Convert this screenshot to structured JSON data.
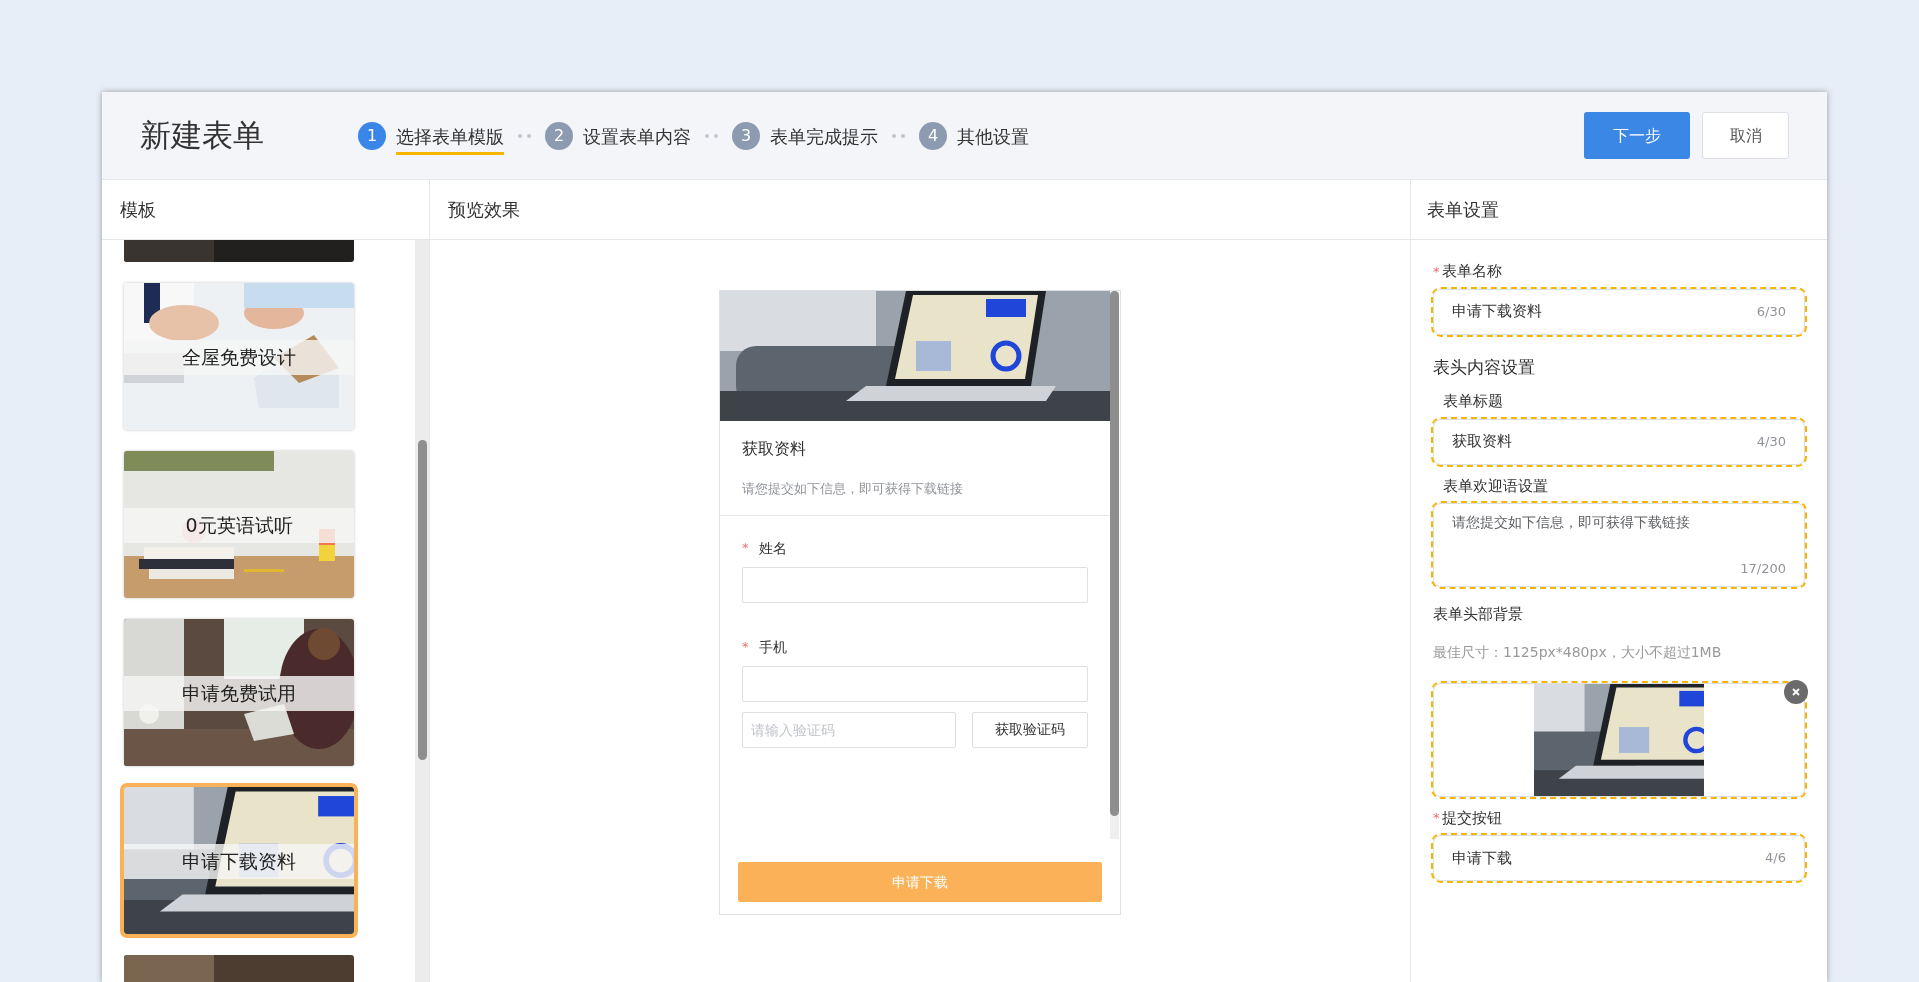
{
  "title": "新建表单",
  "steps": [
    {
      "number": "1",
      "label": "选择表单模版",
      "selected": true
    },
    {
      "number": "2",
      "label": "设置表单内容",
      "selected": false
    },
    {
      "number": "3",
      "label": "表单完成提示",
      "selected": false
    },
    {
      "number": "4",
      "label": "其他设置",
      "selected": false
    }
  ],
  "actions": {
    "next": "下一步",
    "cancel": "取消"
  },
  "columns": {
    "templates": "模板",
    "preview": "预览效果",
    "settings": "表单设置"
  },
  "templates": [
    {
      "selected": false
    },
    {
      "label": "全屋免费设计",
      "selected": false
    },
    {
      "label": "0元英语试听",
      "selected": false
    },
    {
      "label": "申请免费试用",
      "selected": false
    },
    {
      "label": "申请下载资料",
      "selected": true
    },
    {
      "selected": false
    }
  ],
  "preview": {
    "title": "获取资料",
    "welcome": "请您提交如下信息，即可获得下载链接",
    "fields": [
      {
        "label": "姓名",
        "required_mark": "*"
      },
      {
        "label": "手机",
        "required_mark": "*"
      }
    ],
    "code_placeholder": "请输入验证码",
    "code_button": "获取验证码",
    "submit": "申请下载"
  },
  "settings": [
    {
      "kind": "input",
      "label": "表单名称",
      "required_mark": "*",
      "value": "申请下载资料",
      "counter": "6/30",
      "highlighted": true
    },
    {
      "kind": "heading",
      "label": "表头内容设置"
    },
    {
      "kind": "input",
      "label": "表单标题",
      "value": "获取资料",
      "counter": "4/30",
      "highlighted": true
    },
    {
      "kind": "textarea",
      "label": "表单欢迎语设置",
      "value": "请您提交如下信息，即可获得下载链接",
      "counter": "17/200",
      "highlighted": true
    },
    {
      "label": "表单头部背景",
      "hint": "最佳尺寸：1125px*480px，大小不超过1MB",
      "highlighted": true
    },
    {
      "kind": "input",
      "label": "提交按钮",
      "required_mark": "*",
      "value": "申请下载",
      "counter": "4/6",
      "highlighted": true
    }
  ]
}
